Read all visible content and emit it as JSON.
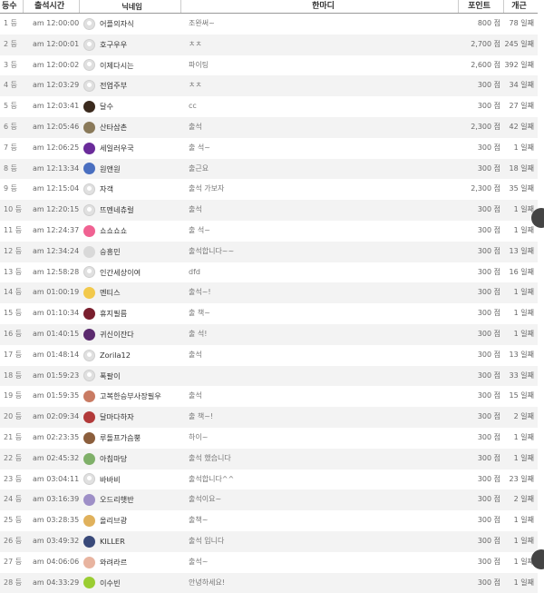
{
  "header": {
    "rank": "등수",
    "time": "출석시간",
    "nickname": "닉네임",
    "message": "한마디",
    "points": "포인트",
    "count": "개근"
  },
  "rows": [
    {
      "rank": "1 등",
      "time": "am 12:00:00",
      "nick": "어플의자식",
      "msg": "조완써~",
      "points": "800 점",
      "count": "78 일째",
      "avatar": "default"
    },
    {
      "rank": "2 등",
      "time": "am 12:00:01",
      "nick": "호구우우",
      "msg": "ㅊㅊ",
      "points": "2,700 점",
      "count": "245 일째",
      "avatar": "default"
    },
    {
      "rank": "3 등",
      "time": "am 12:00:02",
      "nick": "이제다시는",
      "msg": "파이팅",
      "points": "2,600 점",
      "count": "392 일째",
      "avatar": "default"
    },
    {
      "rank": "4 등",
      "time": "am 12:03:29",
      "nick": "전업주부",
      "msg": "ㅊㅊ",
      "points": "300 점",
      "count": "34 일째",
      "avatar": "default"
    },
    {
      "rank": "5 등",
      "time": "am 12:03:41",
      "nick": "달수",
      "msg": "cc",
      "points": "300 점",
      "count": "27 일째",
      "avatar": "#3b2a1e"
    },
    {
      "rank": "6 등",
      "time": "am 12:05:46",
      "nick": "산타삼촌",
      "msg": "출석",
      "points": "2,300 점",
      "count": "42 일째",
      "avatar": "#8a7a5a"
    },
    {
      "rank": "7 등",
      "time": "am 12:06:25",
      "nick": "세일러우국",
      "msg": "출 석~",
      "points": "300 점",
      "count": "1 일째",
      "avatar": "#6a2b9a"
    },
    {
      "rank": "8 등",
      "time": "am 12:13:34",
      "nick": "원앤원",
      "msg": "출근요",
      "points": "300 점",
      "count": "18 일째",
      "avatar": "#4a6fc0"
    },
    {
      "rank": "9 등",
      "time": "am 12:15:04",
      "nick": "자객",
      "msg": "출석 가보자",
      "points": "2,300 점",
      "count": "35 일째",
      "avatar": "default"
    },
    {
      "rank": "10 등",
      "time": "am 12:20:15",
      "nick": "뜨멘네츄럴",
      "msg": "출석",
      "points": "300 점",
      "count": "1 일째",
      "avatar": "default"
    },
    {
      "rank": "11 등",
      "time": "am 12:24:37",
      "nick": "쇼쇼쇼쇼",
      "msg": "출 석~",
      "points": "300 점",
      "count": "1 일째",
      "avatar": "#f06292"
    },
    {
      "rank": "12 등",
      "time": "am 12:34:24",
      "nick": "승흥민",
      "msg": "출석합니다~~",
      "points": "300 점",
      "count": "13 일째",
      "avatar": "#d9d9d9"
    },
    {
      "rank": "13 등",
      "time": "am 12:58:28",
      "nick": "인간세상이여",
      "msg": "dfd",
      "points": "300 점",
      "count": "16 일째",
      "avatar": "default"
    },
    {
      "rank": "14 등",
      "time": "am 01:00:19",
      "nick": "멘티스",
      "msg": "출석~!",
      "points": "300 점",
      "count": "1 일째",
      "avatar": "#f2c94c"
    },
    {
      "rank": "15 등",
      "time": "am 01:10:34",
      "nick": "휴지필름",
      "msg": "출 책~",
      "points": "300 점",
      "count": "1 일째",
      "avatar": "#7a1f2e"
    },
    {
      "rank": "16 등",
      "time": "am 01:40:15",
      "nick": "귀신이잔다",
      "msg": "출 석!",
      "points": "300 점",
      "count": "1 일째",
      "avatar": "#5b2a6e"
    },
    {
      "rank": "17 등",
      "time": "am 01:48:14",
      "nick": "Zorila12",
      "msg": "출석",
      "points": "300 점",
      "count": "13 일째",
      "avatar": "default"
    },
    {
      "rank": "18 등",
      "time": "am 01:59:23",
      "nick": "폭팔이",
      "msg": "",
      "points": "300 점",
      "count": "33 일째",
      "avatar": "default"
    },
    {
      "rank": "19 등",
      "time": "am 01:59:35",
      "nick": "고복한승부사장필우",
      "msg": "출석",
      "points": "300 점",
      "count": "15 일째",
      "avatar": "#c97b63"
    },
    {
      "rank": "20 등",
      "time": "am 02:09:34",
      "nick": "달마다하자",
      "msg": "출 책~!",
      "points": "300 점",
      "count": "2 일째",
      "avatar": "#b23a3a"
    },
    {
      "rank": "21 등",
      "time": "am 02:23:35",
      "nick": "루돌프가슴뿡",
      "msg": "하이~",
      "points": "300 점",
      "count": "1 일째",
      "avatar": "#8b5e3c"
    },
    {
      "rank": "22 등",
      "time": "am 02:45:32",
      "nick": "아침마당",
      "msg": "출석 했습니다",
      "points": "300 점",
      "count": "1 일째",
      "avatar": "#7fb069"
    },
    {
      "rank": "23 등",
      "time": "am 03:04:11",
      "nick": "바바비",
      "msg": "출석합니다^^",
      "points": "300 점",
      "count": "23 일째",
      "avatar": "default"
    },
    {
      "rank": "24 등",
      "time": "am 03:16:39",
      "nick": "오드리햇반",
      "msg": "출석이요~",
      "points": "300 점",
      "count": "2 일째",
      "avatar": "#9e8fc7"
    },
    {
      "rank": "25 등",
      "time": "am 03:28:35",
      "nick": "올리브광",
      "msg": "출책~",
      "points": "300 점",
      "count": "1 일째",
      "avatar": "#e0b15c"
    },
    {
      "rank": "26 등",
      "time": "am 03:49:32",
      "nick": "KILLER",
      "msg": "출석 입니다",
      "points": "300 점",
      "count": "1 일째",
      "avatar": "#3a4a7a"
    },
    {
      "rank": "27 등",
      "time": "am 04:06:06",
      "nick": "와려라르",
      "msg": "출석~",
      "points": "300 점",
      "count": "1 일째",
      "avatar": "#e8b4a0"
    },
    {
      "rank": "28 등",
      "time": "am 04:33:29",
      "nick": "이수빈",
      "msg": "안녕하세요!",
      "points": "300 점",
      "count": "1 일째",
      "avatar": "#9acd32"
    }
  ]
}
